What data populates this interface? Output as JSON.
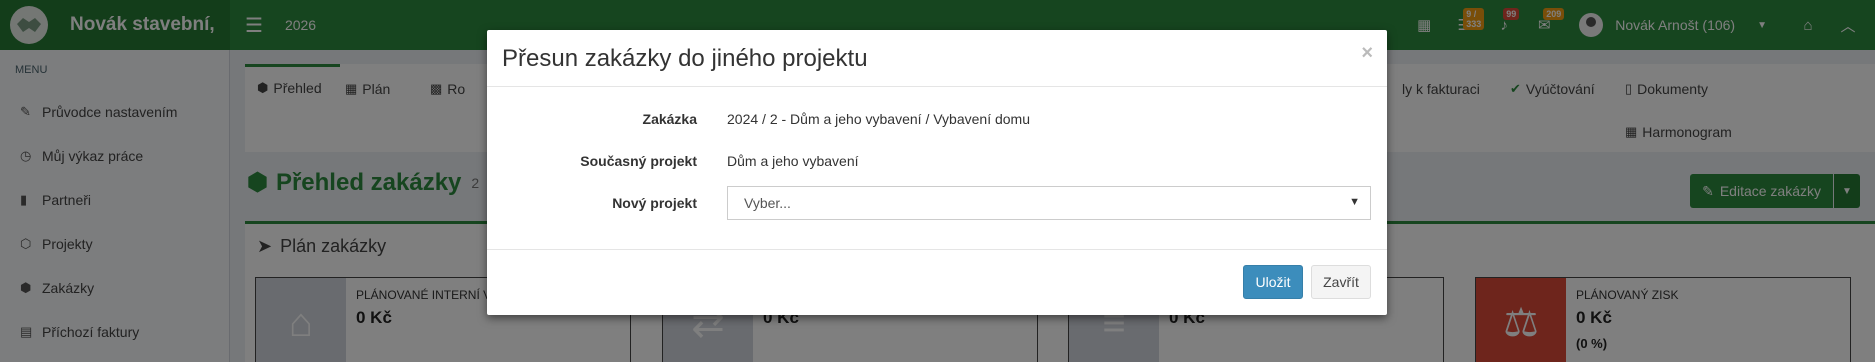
{
  "topbar": {
    "brand": "Novák stavební,",
    "year": "2026",
    "badges": [
      "9 / 333",
      "99",
      "209"
    ],
    "user": "Novák Arnošt (106)"
  },
  "sidebar": {
    "header": "MENU",
    "items": [
      {
        "label": "Průvodce nastavením",
        "icon": "pencil-icon"
      },
      {
        "label": "Můj výkaz práce",
        "icon": "clock-icon"
      },
      {
        "label": "Partneři",
        "icon": "building-icon"
      },
      {
        "label": "Projekty",
        "icon": "cubes-icon"
      },
      {
        "label": "Zakázky",
        "icon": "cube-icon"
      },
      {
        "label": "Příchozí faktury",
        "icon": "invoice-icon"
      }
    ]
  },
  "tabs": {
    "overview": "Přehled",
    "plan": "Plán",
    "partial": "Ro",
    "invoicing": "ly k fakturaci",
    "billing": "Vyúčtování",
    "documents": "Dokumenty",
    "schedule": "Harmonogram"
  },
  "page": {
    "title": "Přehled zakázky",
    "title_suffix": "2",
    "edit_button": "Editace zakázky"
  },
  "plan": {
    "title": "Plán zakázky",
    "boxes": [
      {
        "label": "PLÁNOVANÉ INTERNÍ V",
        "value": "0 Kč",
        "sub": ""
      },
      {
        "label": "",
        "value": "0 Kč",
        "sub": ""
      },
      {
        "label": "",
        "value": "0 Kč",
        "sub": ""
      },
      {
        "label": "PLÁNOVANÝ ZISK",
        "value": "0 Kč",
        "sub": "(0 %)"
      }
    ]
  },
  "modal": {
    "title": "Přesun zakázky do jiného projektu",
    "close_symbol": "×",
    "fields": {
      "order_label": "Zakázka",
      "order_value": "2024 / 2 - Dům a jeho vybavení / Vybavení domu",
      "current_label": "Současný projekt",
      "current_value": "Dům a jeho vybavení",
      "new_label": "Nový projekt",
      "new_placeholder": "Vyber..."
    },
    "save": "Uložit",
    "close": "Zavřít"
  },
  "colors": {
    "brand": "#2d8a3e",
    "primary_button": "#3c8dbc",
    "danger": "#dd4b39",
    "warning": "#f39c12"
  }
}
